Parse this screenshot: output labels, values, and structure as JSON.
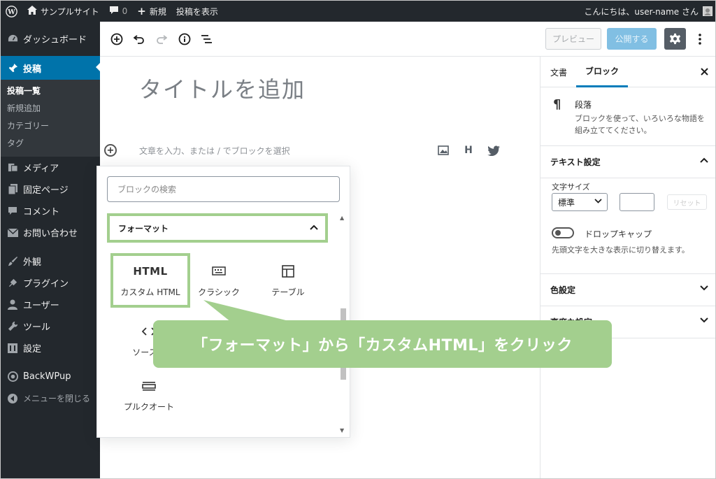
{
  "admin_bar": {
    "site_name": "サンプルサイト",
    "comments_count": "0",
    "new_label": "新規",
    "view_post_label": "投稿を表示",
    "greeting": "こんにちは、user-name さん"
  },
  "sidebar": {
    "dashboard": "ダッシュボード",
    "posts": "投稿",
    "submenu": [
      "投稿一覧",
      "新規追加",
      "カテゴリー",
      "タグ"
    ],
    "items": [
      "メディア",
      "固定ページ",
      "コメント",
      "お問い合わせ"
    ],
    "items2": [
      "外観",
      "プラグイン",
      "ユーザー",
      "ツール",
      "設定"
    ],
    "backwpup": "BackWPup",
    "collapse": "メニューを閉じる"
  },
  "header": {
    "preview_label": "プレビュー",
    "publish_label": "公開する"
  },
  "editor": {
    "title_placeholder": "タイトルを追加",
    "paragraph_placeholder": "文章を入力、または / でブロックを選択",
    "quick_heading": "H"
  },
  "inserter": {
    "search_placeholder": "ブロックの検索",
    "panel_title": "フォーマット",
    "html_glyph": "HTML",
    "blocks": {
      "custom_html": "カスタム HTML",
      "classic": "クラシック",
      "table": "テーブル",
      "source": "ソースコ",
      "pullquote": "プルクオート"
    }
  },
  "settings": {
    "tab_document": "文書",
    "tab_block": "ブロック",
    "block_name": "段落",
    "block_desc": "ブロックを使って、いろいろな物語を組み立ててください。",
    "text_settings": "テキスト設定",
    "font_size_label": "文字サイズ",
    "font_size_value": "標準",
    "reset_label": "リセット",
    "dropcap_label": "ドロップキャップ",
    "dropcap_help": "先頭文字を大きな表示に切り替えます。",
    "color_settings": "色設定",
    "advanced_settings": "高度な設定"
  },
  "callout": {
    "text": "「フォーマット」から「カスタムHTML」をクリック",
    "color": "#a3cf8e"
  },
  "colors": {
    "admin_dark": "#23282d",
    "active_blue": "#0073aa",
    "publish_blue": "#81bfe3",
    "highlight_green": "#a3cf8e"
  }
}
